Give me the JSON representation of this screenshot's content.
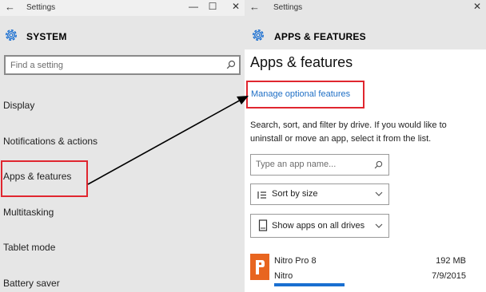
{
  "left_window": {
    "title": "Settings",
    "back_glyph": "←",
    "min_glyph": "—",
    "max_glyph": "☐",
    "close_glyph": "✕",
    "section_title": "SYSTEM",
    "search_placeholder": "Find a setting",
    "nav_items": [
      "Display",
      "Notifications & actions",
      "Apps & features",
      "Multitasking",
      "Tablet mode",
      "Battery saver"
    ],
    "highlighted_item": "Apps & features"
  },
  "right_window": {
    "title": "Settings",
    "back_glyph": "←",
    "close_glyph": "✕",
    "section_title": "APPS & FEATURES",
    "page_title": "Apps & features",
    "manage_link": "Manage optional features",
    "description": "Search, sort, and filter by drive. If you would like to uninstall or move an app, select it from the list.",
    "search_placeholder": "Type an app name...",
    "sort_label": "Sort by size",
    "filter_label": "Show apps on all drives",
    "apps": [
      {
        "name": "Nitro Pro 8",
        "publisher": "Nitro",
        "size": "192 MB",
        "date": "7/9/2015",
        "icon": "nitro-pdf-icon",
        "icon_color": "#e8651f"
      }
    ]
  },
  "annotation": {
    "highlight_color": "#e0262f",
    "arrow_color": "#000000"
  }
}
